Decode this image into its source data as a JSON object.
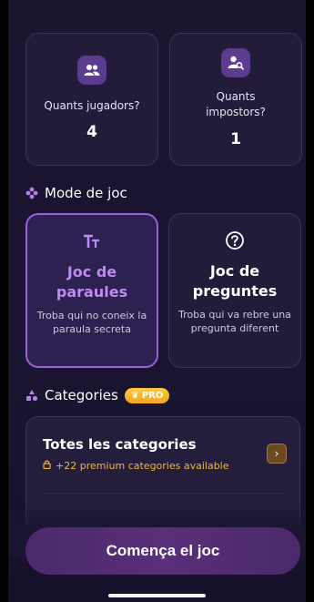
{
  "players": {
    "label": "Quants jugadors?",
    "value": "4",
    "icon": "players-icon"
  },
  "impostors": {
    "label": "Quants impostors?",
    "value": "1",
    "icon": "impostor-search-icon"
  },
  "mode_section": {
    "title": "Mode de joc",
    "icon": "sparkle-icon"
  },
  "modes": [
    {
      "icon": "Tт",
      "title": "Joc de paraules",
      "desc": "Troba qui no coneix la paraula secreta",
      "selected": true
    },
    {
      "icon": "?",
      "title": "Joc de preguntes",
      "desc": "Troba qui va rebre una pregunta diferent",
      "selected": false
    }
  ],
  "categories_section": {
    "title": "Categories",
    "badge": "PRO"
  },
  "category_card": {
    "title": "Totes les categories",
    "subtitle": "+22 premium categories available"
  },
  "start_button": {
    "label": "Comença el joc"
  },
  "colors": {
    "accent": "#9b5fe0",
    "gold": "#f0b63a",
    "background": "#1b1530"
  }
}
